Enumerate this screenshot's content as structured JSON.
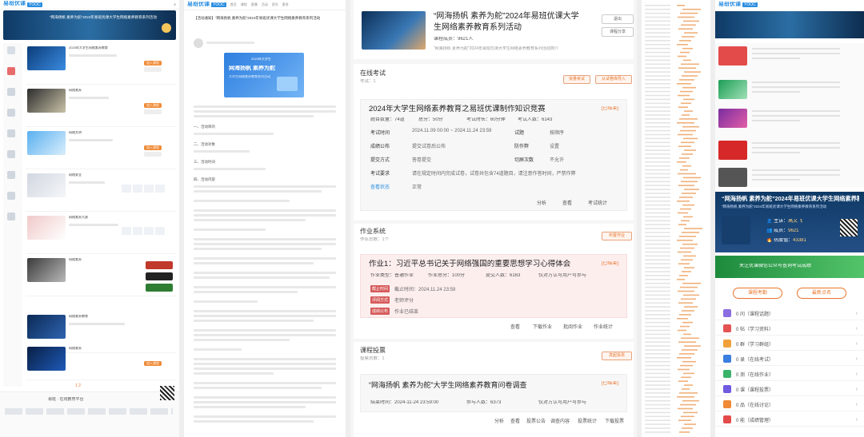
{
  "brand": {
    "name": "易班优课",
    "badge": "YOOC"
  },
  "p1": {
    "banner_title": "“网海扬帆 素养为舵”2024年易班优课大学生网络素养教育系列活动",
    "items": [
      "2023年大学生网络素养教育",
      "网络素养",
      "网络文明",
      "网络安全",
      "网络素养大赛",
      "网络素养",
      "网络素养教育",
      "网络素养",
      "网络素养活动",
      "网络素养"
    ],
    "side_labels": [
      "",
      "",
      "",
      ""
    ],
    "item_btn": "加入课程",
    "footer": "易班 · 在线教育平台",
    "page": "1 2"
  },
  "p2": {
    "nav": [
      "首页",
      "课程",
      "直播",
      "活动",
      "资讯",
      "更多"
    ],
    "article_title": "【活动通知】“网海扬帆 素养为舵”2024年易班优课大学生网络素养教育系列活动",
    "poster_top": "2024年大学生",
    "poster_main": "网海扬帆 素养为舵",
    "poster_sub": "大学生网络素养教育系列活动",
    "sections": [
      "一、活动目的",
      "二、活动对象",
      "三、活动时间",
      "四、活动内容"
    ]
  },
  "p3": {
    "course_title": "“网海扬帆 素养为舵”2024年易班优课大学生网络素养教育系列活动",
    "course_members": "课程成员：9621人",
    "course_desc": "“网海扬帆 素养为舵”2024年易班优课大学生网络素养教育系列活动简介",
    "btn_top1": "退出",
    "btn_top2": "课程分享",
    "exam_section": "在线考试",
    "exam_count": "考试：1",
    "exam_btn1": "批量考试",
    "exam_btn2": "从试卷库导入",
    "exam": {
      "title": "2024年大学生网络素养教育之易班优课制作知识竞赛",
      "status": "[已结束]",
      "stats": [
        "题目数量：74道",
        "总分：50分",
        "考试时长：60分钟",
        "考试人数：6143"
      ],
      "rows": [
        {
          "l": "考试时间",
          "v": "2024.11.09 00:00 ~ 2024.11.24 23:59",
          "l2": "试题",
          "v2": "按顺序"
        },
        {
          "l": "成绩公布",
          "v": "提交试卷后公布",
          "l2": "防作弊",
          "v2": "设置"
        },
        {
          "l": "提交方式",
          "v": "答卷提交",
          "l2": "切屏次数",
          "v2": "不允许"
        },
        {
          "l": "考试要求",
          "v": "请在规定时间内完成试卷，试卷共包含74道题目，请注意作答时间，严禁作弊",
          "l2": "",
          "v2": ""
        },
        {
          "l": "查看状态",
          "v": "正常",
          "l2": "",
          "v2": ""
        }
      ],
      "foot": [
        "分析",
        "查看",
        "考试统计"
      ]
    },
    "hw_section": "作业系统",
    "hw_count": "作业总数：1个",
    "hw_btn": "布置作业",
    "hw": {
      "title": "作业1：习近平总书记关于网络强国的重要思想学习心得体会",
      "status": "[已结束]",
      "stats": [
        "作业类型：普通作业",
        "作业总分：100分",
        "提交人数：6163",
        "仅对方认可用户可参与"
      ],
      "tags": [
        "截止时间",
        "评阅方式",
        "成绩公布"
      ],
      "vals": [
        "截止时间：2024.11.24 23:59",
        "老师评分",
        "作业已结束"
      ],
      "foot": [
        "查看",
        "下载作业",
        "批阅作业",
        "作业统计"
      ]
    },
    "vote_section": "课程投票",
    "vote_count": "投票总数：1",
    "vote_btn": "发起投票",
    "vote": {
      "title": "“网海扬帆 素养为舵”大学生网络素养教育问卷调查",
      "status": "[已结束]",
      "stats": [
        "结束时间：2024-11-24 23:59:00",
        "参与人数：6373",
        "仅对方认可用户可参与"
      ],
      "foot": [
        "分析",
        "查看",
        "投票公告",
        "调查内容",
        "投票统计",
        "下载投票"
      ]
    }
  },
  "p5": {
    "course_title": "“网海扬帆 素养为舵”2024年易班优课大学生网络素养教育系列活动",
    "teacher_label": "主讲：",
    "teacher": "高文飞",
    "members_label": "成员：",
    "members": "9621",
    "heat_label": "热度值：",
    "heat": "43381",
    "promo": "关注优课微信公众号查询考试成绩",
    "btn1": "课程考勤",
    "btn2": "最新点名",
    "menu": [
      "0 问（课程话题）",
      "0 帖（学习资料）",
      "0 群（学习群组）",
      "0 录（在线考试）",
      "0 测（在线作业）",
      "0 课（课程投票）",
      "0 品（在线讨论）",
      "0 能（成绩管理）"
    ]
  },
  "colors": {
    "accent": "#f08a36",
    "brand": "#2a8ee0",
    "ended": "#d65a5a"
  }
}
